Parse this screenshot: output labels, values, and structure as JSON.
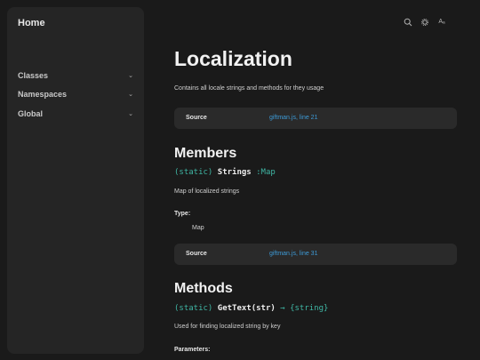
{
  "sidebar": {
    "home": "Home",
    "items": [
      {
        "label": "Classes"
      },
      {
        "label": "Namespaces"
      },
      {
        "label": "Global"
      }
    ]
  },
  "header_icons": [
    "search-icon",
    "gear-icon",
    "font-size-icon"
  ],
  "page": {
    "title": "Localization",
    "description": "Contains all locale strings and methods for they usage",
    "source1": {
      "label": "Source",
      "link": "giftman.js, line 21"
    },
    "members": {
      "heading": "Members",
      "sig_static": "(static)",
      "sig_name": "Strings",
      "sig_type": ":Map",
      "description": "Map of localized strings",
      "type_label": "Type:",
      "type_value": "Map"
    },
    "source2": {
      "label": "Source",
      "link": "giftman.js, line 31"
    },
    "methods": {
      "heading": "Methods",
      "sig_static": "(static)",
      "sig_name": "GetText(str)",
      "sig_return": "→ {string}",
      "description": "Used for finding localized string by key",
      "params_label": "Parameters:"
    }
  },
  "colors": {
    "accent": "#3fb6a4",
    "link": "#3d9ad6",
    "background": "#1a1a1a",
    "panel": "#252525"
  }
}
